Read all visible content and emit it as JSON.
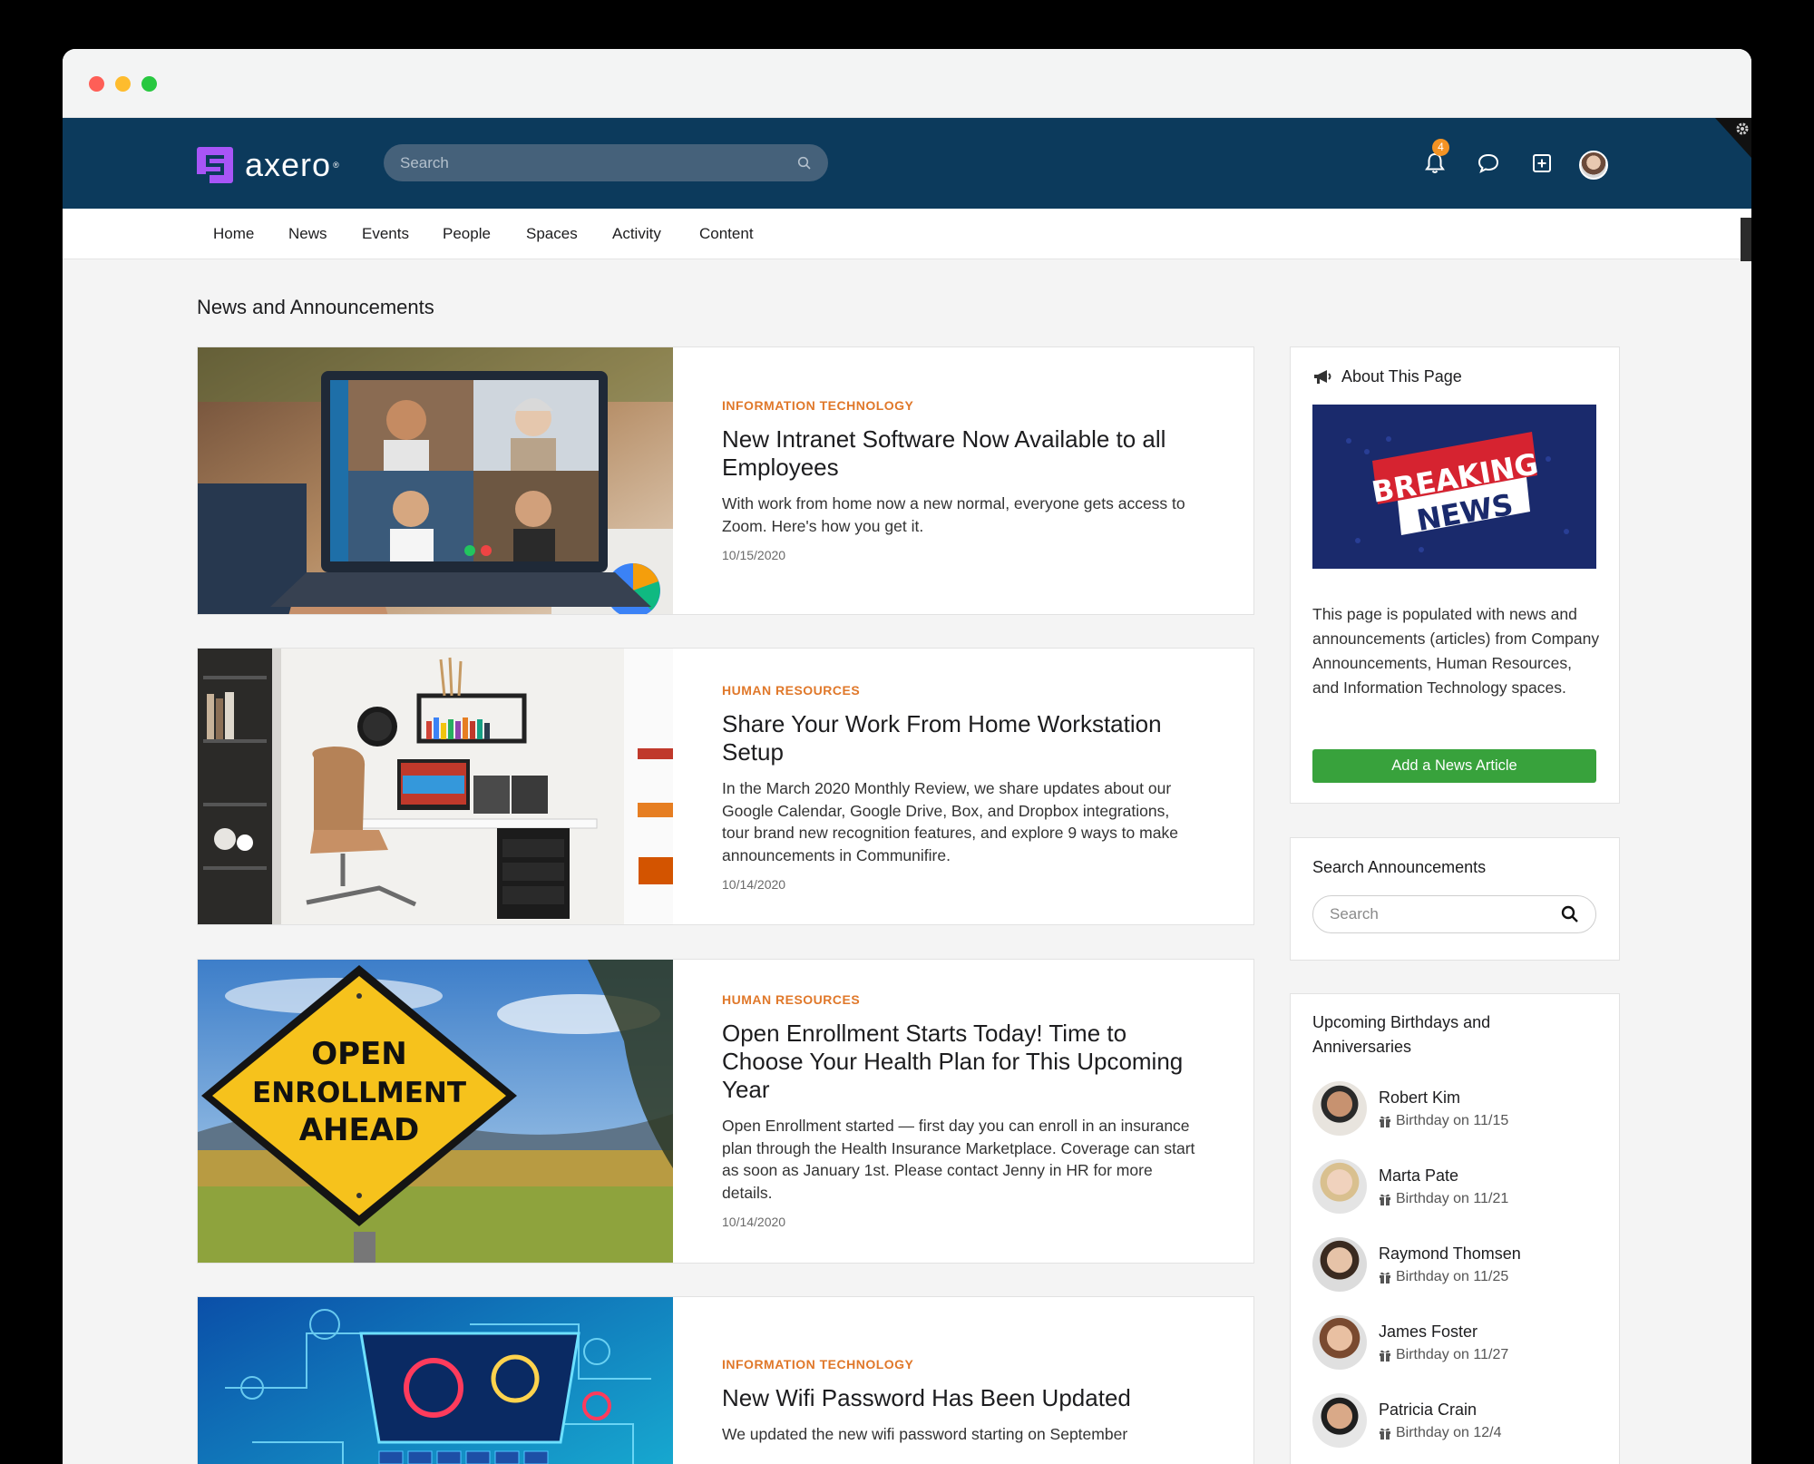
{
  "app": {
    "logo_text": "axero"
  },
  "header": {
    "search_placeholder": "Search",
    "notification_count": "4",
    "accent_color": "#0c3a5c",
    "badge_color": "#f39324"
  },
  "nav": {
    "items": [
      "Home",
      "News",
      "Events",
      "People",
      "Spaces",
      "Activity",
      "Content"
    ]
  },
  "main": {
    "title": "News and Announcements",
    "articles": [
      {
        "category": "INFORMATION TECHNOLOGY",
        "title": "New Intranet Software Now Available to all Employees",
        "description": "With work from home now a new normal, everyone gets access to Zoom. Here's how you get it.",
        "date": "10/15/2020"
      },
      {
        "category": "HUMAN RESOURCES",
        "title": "Share Your Work From Home Workstation Setup",
        "description": "In the March 2020 Monthly Review, we share updates about our Google Calendar, Google Drive, Box, and Dropbox integrations, tour brand new recognition features, and explore 9 ways to make announcements in Communifire.",
        "date": "10/14/2020"
      },
      {
        "category": "HUMAN RESOURCES",
        "title": "Open Enrollment Starts Today! Time to Choose Your Health Plan for This Upcoming Year",
        "description": "Open Enrollment started — first day you can enroll in an insurance plan through the Health Insurance Marketplace. Coverage can start as soon as January 1st. Please contact Jenny in HR for more details.",
        "date": "10/14/2020",
        "sign_lines": [
          "OPEN",
          "ENROLLMENT",
          "AHEAD"
        ]
      },
      {
        "category": "INFORMATION TECHNOLOGY",
        "title": "New Wifi Password Has Been Updated",
        "description": "We updated the new wifi password starting on September"
      }
    ]
  },
  "sidebar": {
    "about": {
      "title": "About This Page",
      "banner_line1": "BREAKING",
      "banner_line2": "NEWS",
      "text": "This page is populated with news and announcements (articles) from Company Announcements, Human Resources, and Information Technology spaces.",
      "button_label": "Add a News Article",
      "button_color": "#38a23c"
    },
    "search": {
      "title": "Search Announcements",
      "placeholder": "Search"
    },
    "birthdays": {
      "title": "Upcoming Birthdays and Anniversaries",
      "people": [
        {
          "name": "Robert Kim",
          "meta": "Birthday on 11/15"
        },
        {
          "name": "Marta Pate",
          "meta": "Birthday on 11/21"
        },
        {
          "name": "Raymond Thomsen",
          "meta": "Birthday on 11/25"
        },
        {
          "name": "James Foster",
          "meta": "Birthday on 11/27"
        },
        {
          "name": "Patricia Crain",
          "meta": "Birthday on 12/4"
        }
      ]
    }
  }
}
